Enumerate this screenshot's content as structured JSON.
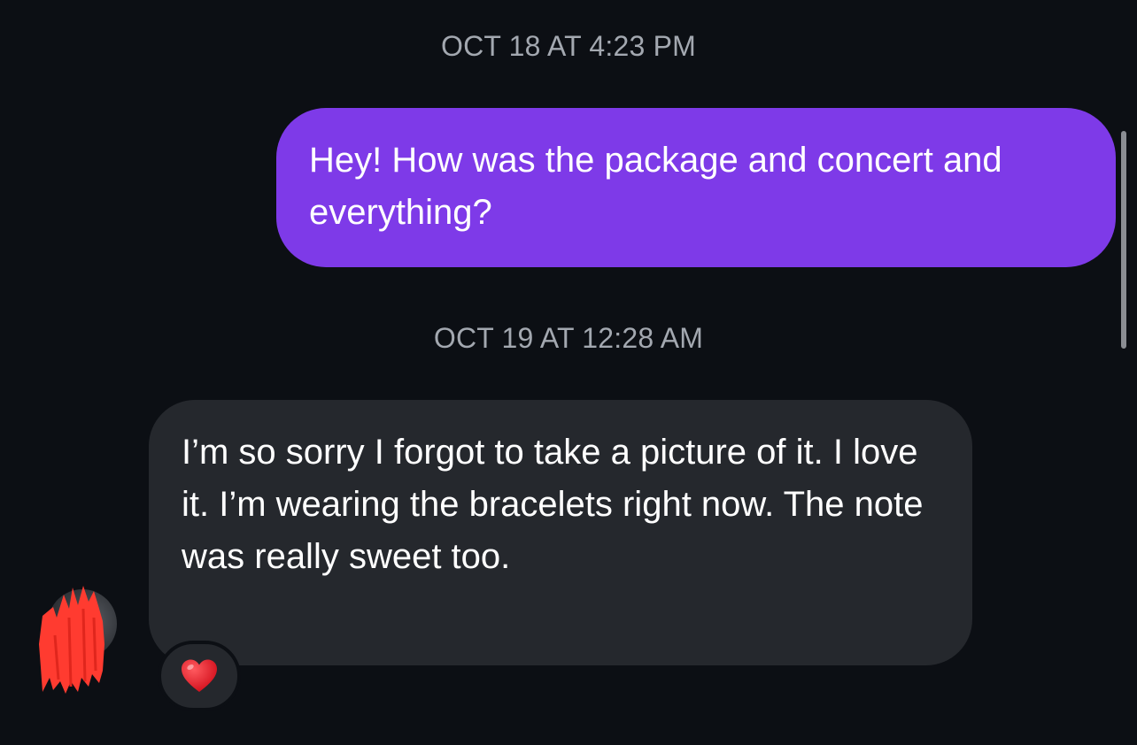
{
  "thread": {
    "messages": [
      {
        "timestamp": "OCT 18 AT 4:23 PM",
        "direction": "outgoing",
        "text": "Hey! How was the package and concert and everything?"
      },
      {
        "timestamp": "OCT 19 AT 12:28 AM",
        "direction": "incoming",
        "text": "I’m so sorry I forgot to take a picture of it. I love it. I’m wearing the bracelets right now. The note was really sweet too.",
        "reaction": "heart-emoji"
      }
    ]
  },
  "colors": {
    "background": "#0c0f14",
    "outgoing_bubble": "#7e3ae8",
    "incoming_bubble": "#25282d",
    "timestamp_text": "#a3a8b0",
    "reaction_heart": "#e8141f",
    "redaction_mark": "#ff3b30"
  },
  "icons": {
    "reaction": "heart-emoji",
    "avatar": "avatar"
  }
}
